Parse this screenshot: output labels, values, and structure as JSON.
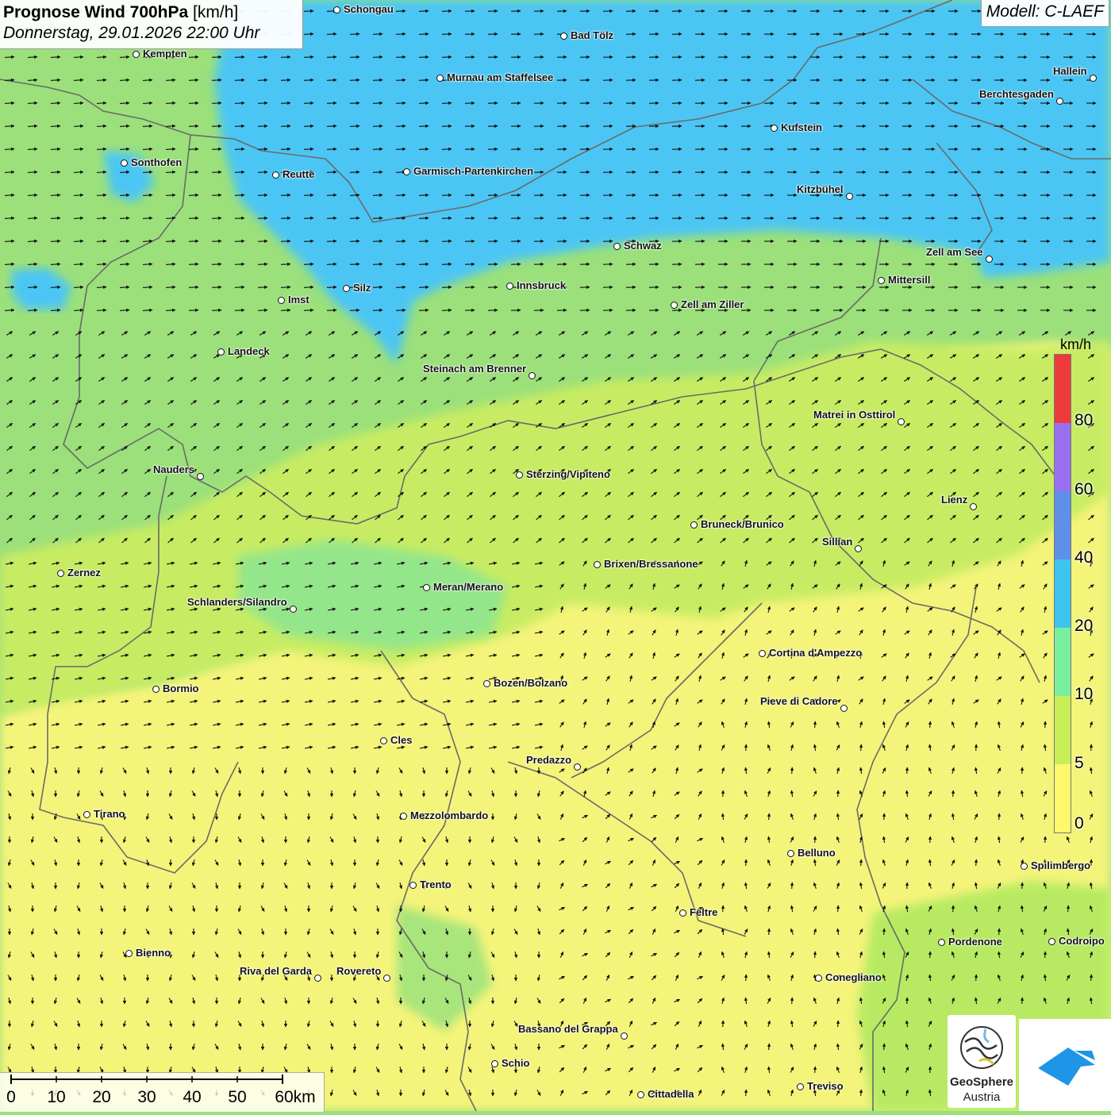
{
  "header": {
    "title_bold": "Prognose Wind 700hPa",
    "title_unit": "[km/h]",
    "datetime": "Donnerstag, 29.01.2026 22:00 Uhr",
    "model": "Modell: C-LAEF"
  },
  "legend": {
    "unit": "km/h",
    "ticks": [
      "0",
      "5",
      "10",
      "20",
      "40",
      "60",
      "80"
    ],
    "colors": [
      "#fff86a",
      "#c8ef55",
      "#78ee9e",
      "#3fc4f0",
      "#5f90e8",
      "#9a6ff0",
      "#ee3a3a"
    ]
  },
  "scale": {
    "labels": [
      "0",
      "10",
      "20",
      "30",
      "40",
      "50",
      "60km"
    ]
  },
  "logo": {
    "name_line1": "GeoSphere",
    "name_line2": "Austria"
  },
  "colors": {
    "fast_wind_blue": "#4cc6f4",
    "moderate_green": "#94e68a",
    "light_green": "#c7ec64",
    "calm_yellow": "#f4f47a",
    "border_gray": "#666666",
    "arrow": "#111111"
  },
  "cities": [
    "Schongau",
    "Bad Tölz",
    "Kempten",
    "Murnau am Staffelsee",
    "Hallein",
    "Berchtesgaden",
    "Kufstein",
    "Sonthofen",
    "Reutte",
    "Garmisch-Partenkirchen",
    "Kitzbühel",
    "Schwaz",
    "Zell am See",
    "Mittersill",
    "Innsbruck",
    "Imst",
    "Silz",
    "Zell am Ziller",
    "Landeck",
    "Steinach am Brenner",
    "Matrei in Osttirol",
    "Nauders",
    "Sterzing/Vipiteno",
    "Lienz",
    "Bruneck/Brunico",
    "Sillian",
    "Brixen/Bressanone",
    "Zernez",
    "Meran/Merano",
    "Schlanders/Silandro",
    "Cortina d'Ampezzo",
    "Bozen/Bolzano",
    "Bormio",
    "Pieve di Cadore",
    "Cles",
    "Predazzo",
    "Tirano",
    "Mezzolombardo",
    "Belluno",
    "Spilimbergo",
    "Trento",
    "Feltre",
    "Pordenone",
    "Codroipo",
    "Bienno",
    "Riva del Garda",
    "Rovereto",
    "Conegliano",
    "Bassano del Grappa",
    "Schio",
    "Treviso",
    "Cittadella"
  ]
}
